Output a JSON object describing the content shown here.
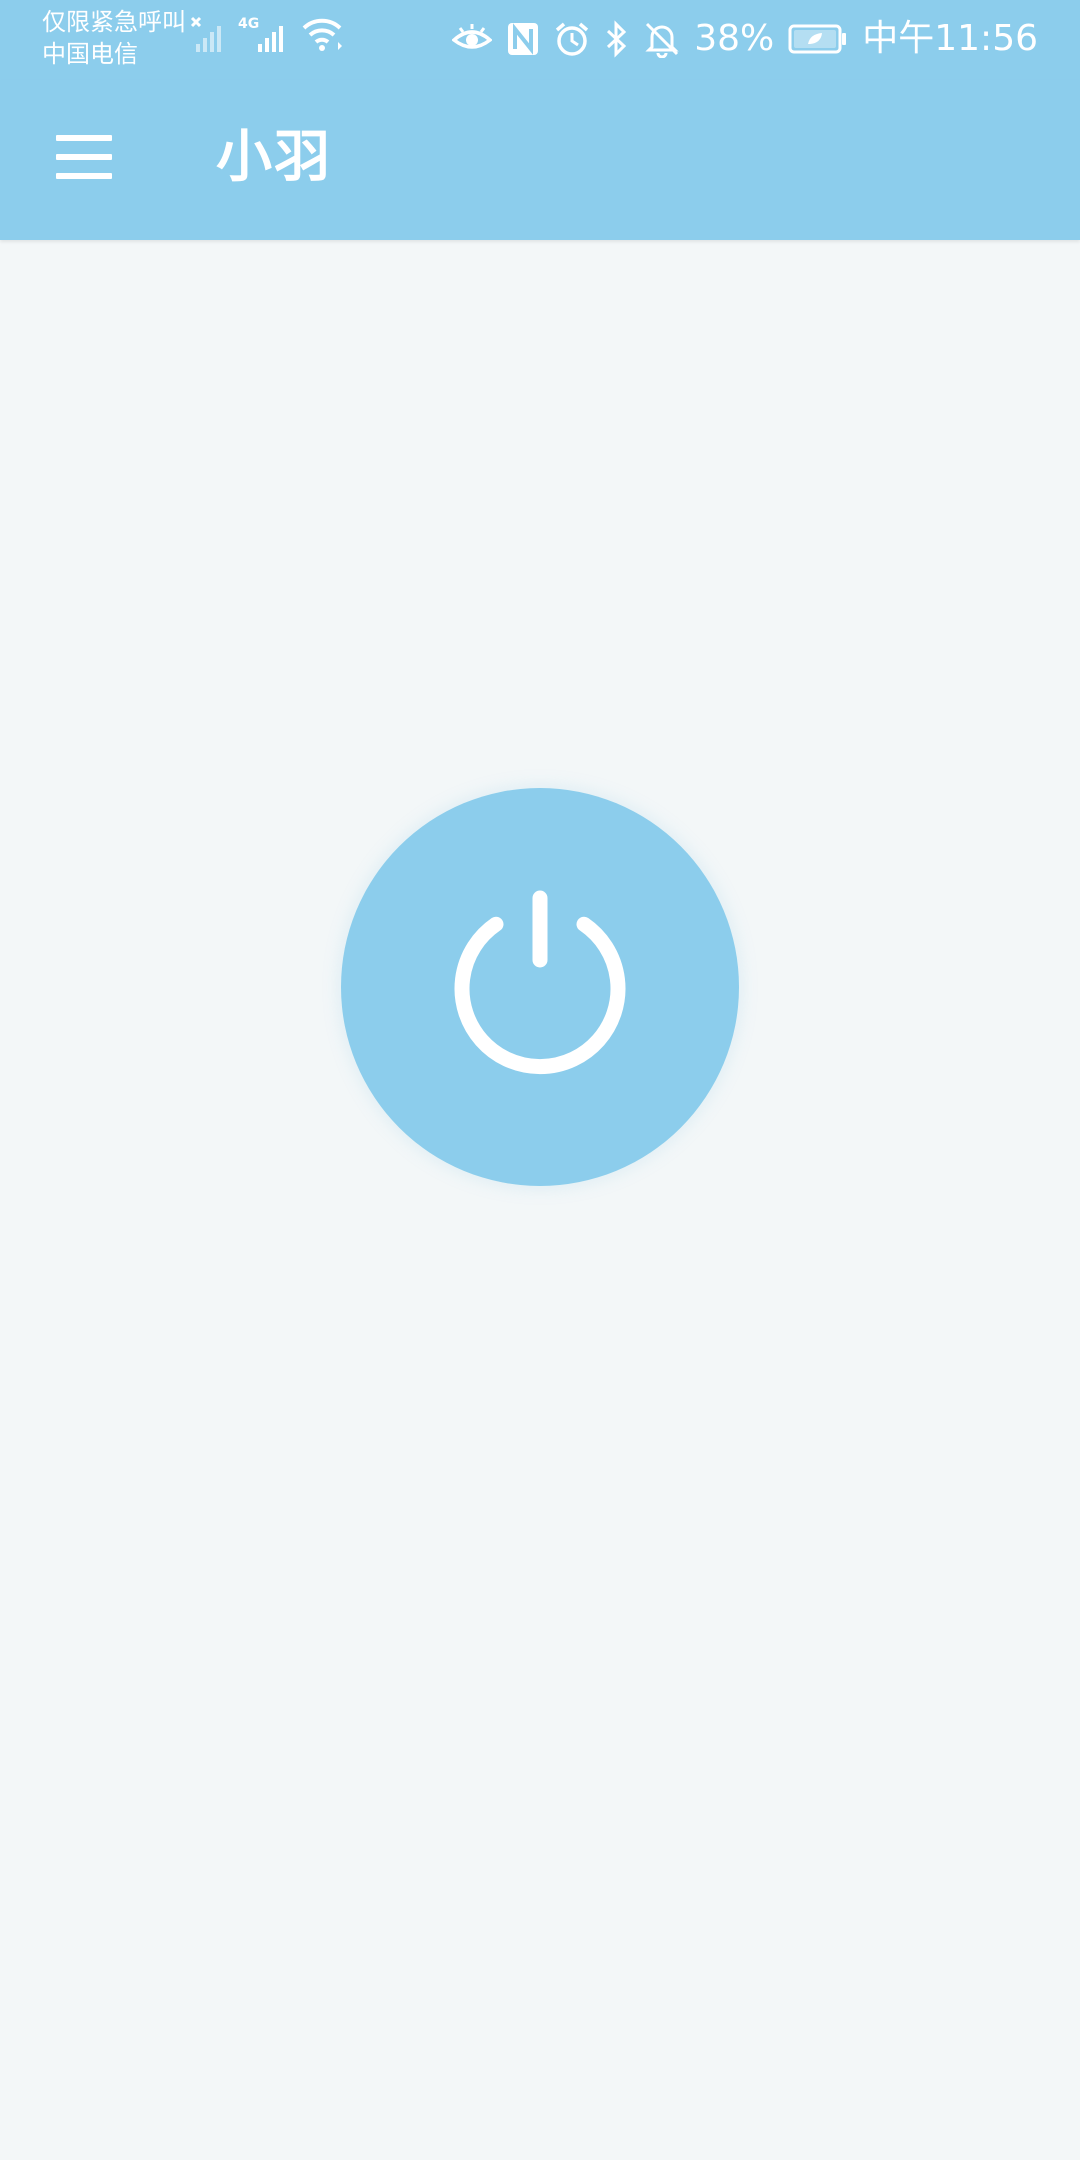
{
  "status_bar": {
    "carrier_line1": "仅限紧急呼叫",
    "carrier_line2": "中国电信",
    "network_type": "4G",
    "battery_percent": "38%",
    "time": "中午11:56",
    "icons": [
      "signal-x-icon",
      "signal-4g-icon",
      "wifi-icon",
      "eye-icon",
      "nfc-icon",
      "alarm-icon",
      "bluetooth-icon",
      "mute-icon",
      "battery-icon"
    ]
  },
  "app_bar": {
    "title": "小羽",
    "menu_icon": "hamburger-menu-icon"
  },
  "main": {
    "power_icon": "power-icon"
  },
  "colors": {
    "accent": "#8ccdec",
    "background": "#f3f7f8",
    "foreground": "#ffffff"
  }
}
